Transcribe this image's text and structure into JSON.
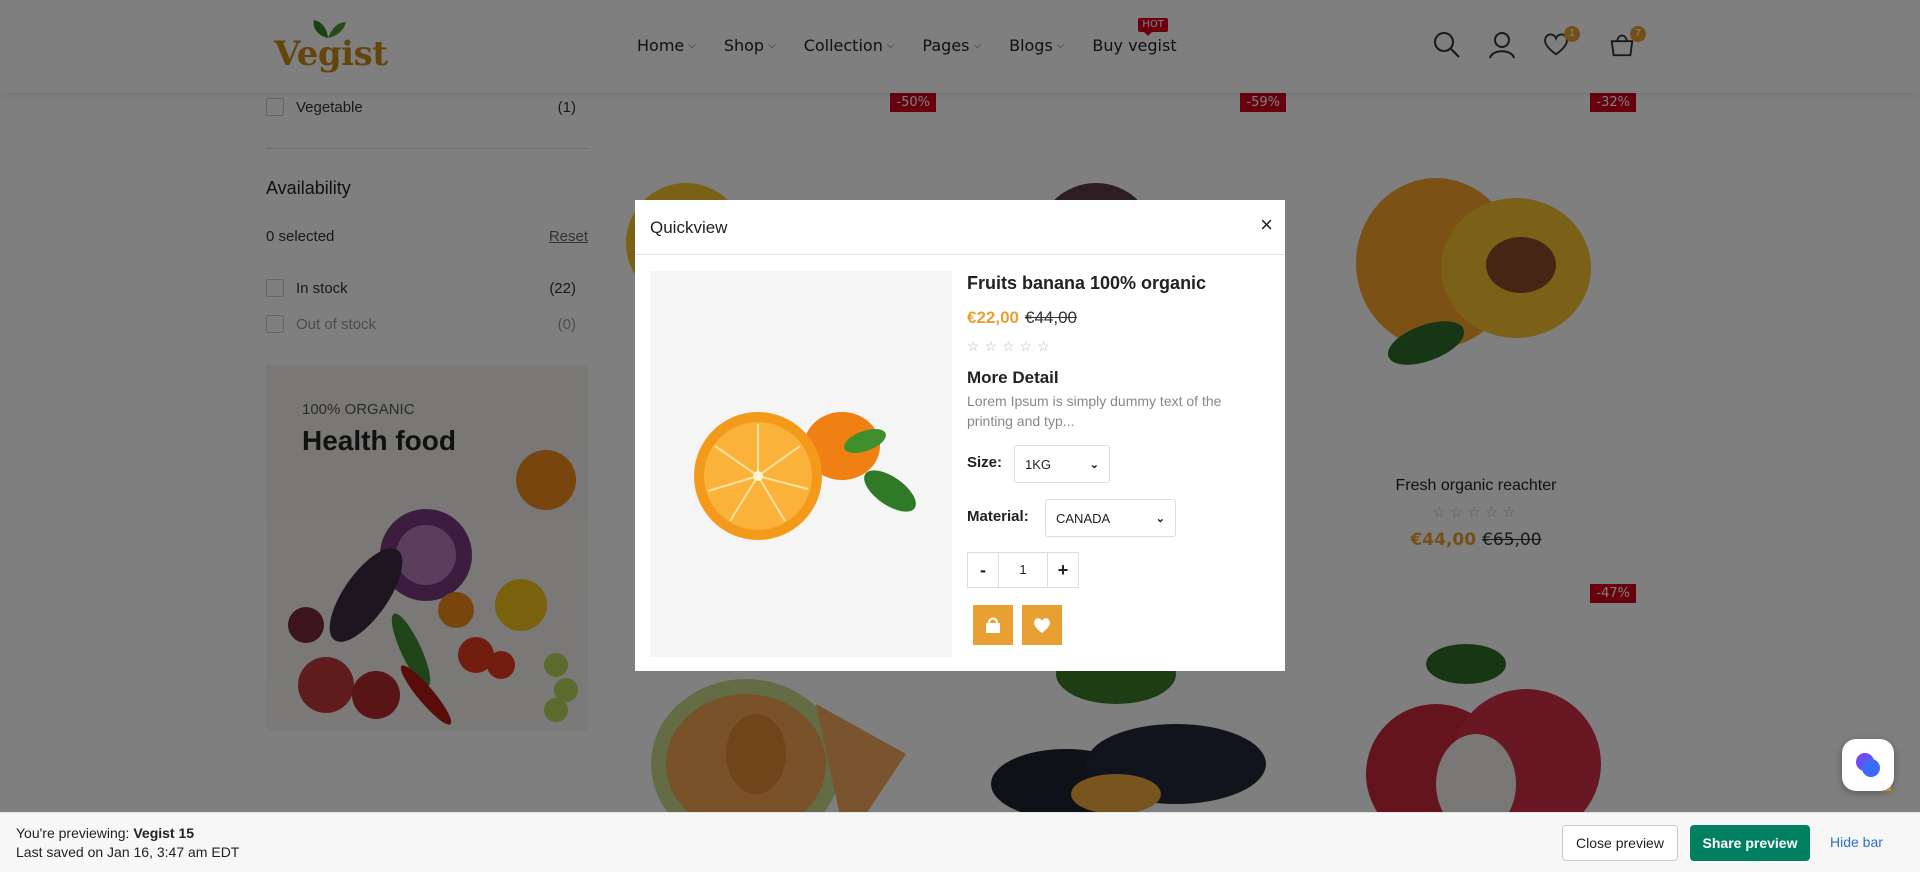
{
  "header": {
    "logo": "Vegist",
    "nav": [
      {
        "label": "Home"
      },
      {
        "label": "Shop"
      },
      {
        "label": "Collection"
      },
      {
        "label": "Pages"
      },
      {
        "label": "Blogs"
      },
      {
        "label": "Buy vegist",
        "badge": "HOT"
      }
    ],
    "wishlist_count": "1",
    "cart_count": "7"
  },
  "sidebar": {
    "vegetable": {
      "label": "Vegetable",
      "count": "(1)"
    },
    "availability_title": "Availability",
    "selected_text": "0 selected",
    "reset_label": "Reset",
    "in_stock": {
      "label": "In stock",
      "count": "(22)"
    },
    "out_of_stock": {
      "label": "Out of stock",
      "count": "(0)"
    },
    "promo": {
      "subtitle": "100% ORGANIC",
      "title": "Health food"
    }
  },
  "products": {
    "discounts": [
      "-50%",
      "-59%",
      "-32%",
      "-47%"
    ],
    "featured": {
      "name": "Fresh organic reachter",
      "stars": "☆☆☆☆☆",
      "price": "€44,00",
      "old_price": "€65,00"
    }
  },
  "modal": {
    "title": "Quickview",
    "close": "×",
    "product_name": "Fruits banana 100% organic",
    "price": "€22,00",
    "old_price": "€44,00",
    "stars": "☆☆☆☆☆",
    "detail_title": "More Detail",
    "description": "Lorem Ipsum is simply dummy text of the printing and typ...",
    "size_label": "Size:",
    "size_value": "1KG",
    "material_label": "Material:",
    "material_value": "CANADA",
    "qty_minus": "-",
    "qty_value": "1",
    "qty_plus": "+"
  },
  "preview_bar": {
    "line1_prefix": "You're previewing: ",
    "theme_name": "Vegist 15",
    "line2": "Last saved on Jan 16, 3:47 am EDT",
    "close_preview": "Close preview",
    "share_preview": "Share preview",
    "hide_bar": "Hide bar"
  },
  "colors": {
    "accent": "#e8a033",
    "logo": "#c88a16",
    "discount": "#d0021b",
    "share": "#008060",
    "link": "#2c6ecb"
  },
  "icons": [
    "search-icon",
    "user-icon",
    "heart-icon",
    "bag-icon",
    "cart-icon",
    "close-icon",
    "chevron-down-icon"
  ]
}
